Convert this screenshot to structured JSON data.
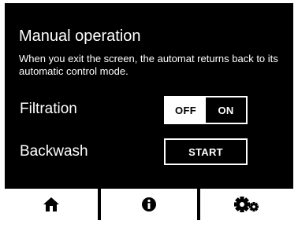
{
  "screen": {
    "title": "Manual operation",
    "description": "When you exit the screen, the automat returns back to its automatic control mode."
  },
  "filtration": {
    "label": "Filtration",
    "off_label": "OFF",
    "on_label": "ON",
    "selected": "OFF"
  },
  "backwash": {
    "label": "Backwash",
    "start_label": "START"
  },
  "nav": {
    "items": [
      {
        "icon": "home-icon"
      },
      {
        "icon": "info-icon"
      },
      {
        "icon": "settings-gears-icon"
      }
    ]
  },
  "colors": {
    "background": "#000000",
    "foreground": "#ffffff"
  }
}
